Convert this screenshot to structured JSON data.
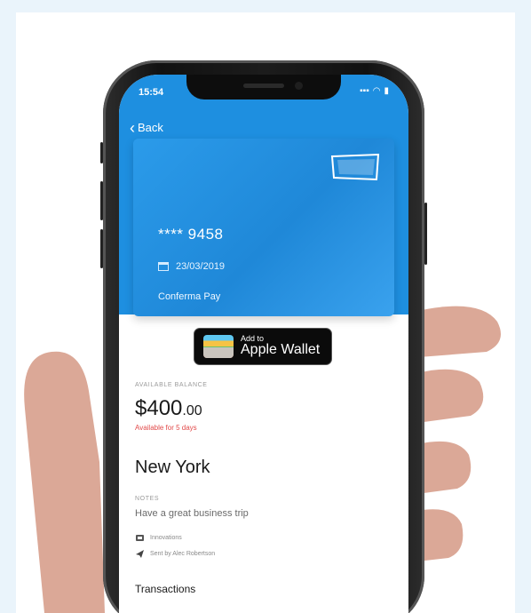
{
  "status": {
    "time": "15:54",
    "signal": "...",
    "wifi": "wifi-icon",
    "battery": "battery-icon"
  },
  "nav": {
    "back_label": "Back"
  },
  "card": {
    "logo_text": "conferma pay",
    "number": "**** 9458",
    "expiry": "23/03/2019",
    "name": "Conferma Pay"
  },
  "wallet_button": {
    "line1": "Add to",
    "line2": "Apple Wallet"
  },
  "balance": {
    "label": "AVAILABLE BALANCE",
    "amount": "$400",
    "cents": ".00",
    "note": "Available for 5 days"
  },
  "destination": {
    "city": "New York"
  },
  "notes": {
    "label": "NOTES",
    "text": "Have a great business trip",
    "company": "Innovations",
    "sent_by": "Sent by Alec Robertson"
  },
  "transactions": {
    "title": "Transactions"
  },
  "colors": {
    "brand_blue": "#1e8fe0",
    "warning_red": "#e24a4a",
    "hand": "#dba897",
    "background": "#eaf4fb"
  }
}
